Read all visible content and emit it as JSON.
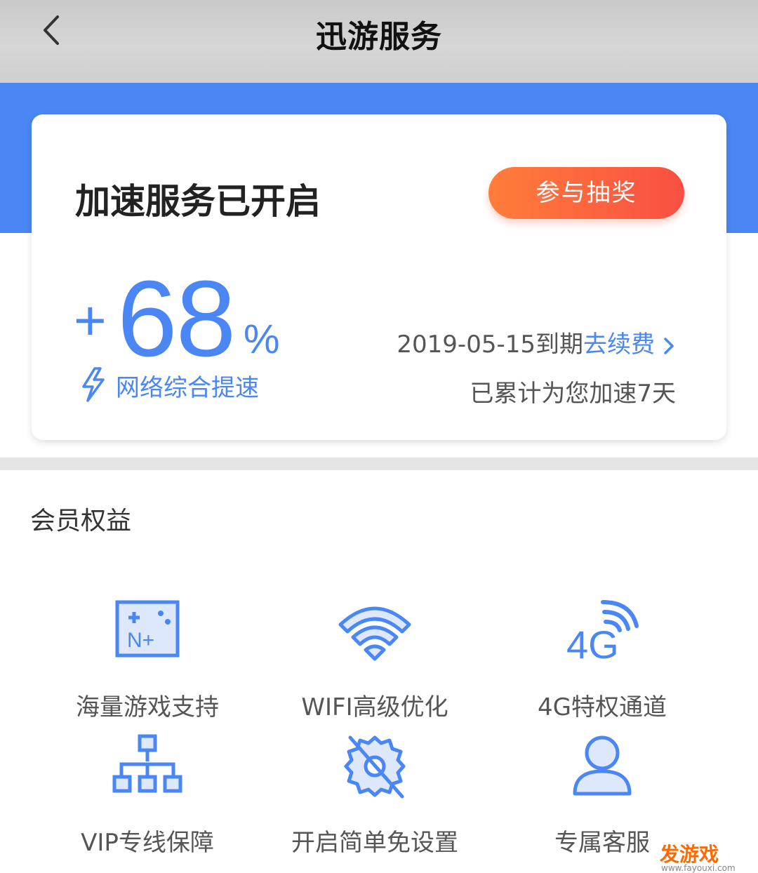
{
  "header": {
    "title": "迅游服务"
  },
  "card": {
    "status_title": "加速服务已开启",
    "lottery_button": "参与抽奖",
    "speed_plus": "+",
    "speed_value": "68",
    "speed_percent": "%",
    "speed_label": "网络综合提速",
    "expire_text": "2019-05-15到期",
    "renew_link": "去续费",
    "accumulated": "已累计为您加速7天"
  },
  "benefits": {
    "title": "会员权益",
    "items": [
      {
        "label": "海量游戏支持",
        "icon": "game-n-plus-icon"
      },
      {
        "label": "WIFI高级优化",
        "icon": "wifi-icon"
      },
      {
        "label": "4G特权通道",
        "icon": "4g-signal-icon"
      },
      {
        "label": "VIP专线保障",
        "icon": "network-tree-icon"
      },
      {
        "label": "开启简单免设置",
        "icon": "no-settings-gear-icon"
      },
      {
        "label": "专属客服",
        "icon": "user-icon"
      }
    ]
  },
  "watermark": {
    "text": "发游戏",
    "url": "www.fayouxi.com"
  },
  "colors": {
    "accent": "#4a86f4",
    "button_start": "#ff7d3b",
    "button_end": "#f94f42",
    "header_bg": "#cfcfcf"
  }
}
